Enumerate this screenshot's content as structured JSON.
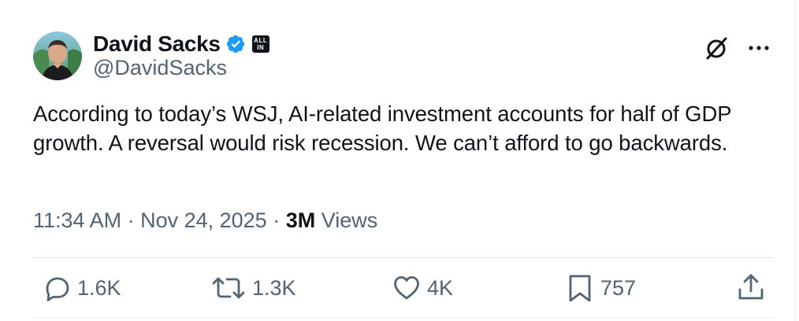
{
  "author": {
    "display_name": "David Sacks",
    "handle": "@DavidSacks",
    "verified": true,
    "affiliate_badge": [
      "ALL",
      "IN"
    ]
  },
  "tweet": {
    "text": "According to today’s WSJ, AI-related investment accounts for half of GDP growth. A reversal would risk recession. We can’t afford to go backwards.",
    "time": "11:34 AM",
    "separator": " · ",
    "date": "Nov 24, 2025",
    "views_count": "3M",
    "views_label": " Views"
  },
  "actions": {
    "replies": "1.6K",
    "reposts": "1.3K",
    "likes": "4K",
    "bookmarks": "757"
  },
  "icons": {
    "reply": "reply-icon",
    "repost": "repost-icon",
    "like": "like-icon",
    "bookmark": "bookmark-icon",
    "share": "share-icon",
    "grok": "grok-icon",
    "more": "more-icon",
    "verified": "verified-icon"
  },
  "colors": {
    "text": "#0f1419",
    "secondary": "#536471",
    "verified": "#1d9bf0",
    "divider": "#eff3f4"
  }
}
